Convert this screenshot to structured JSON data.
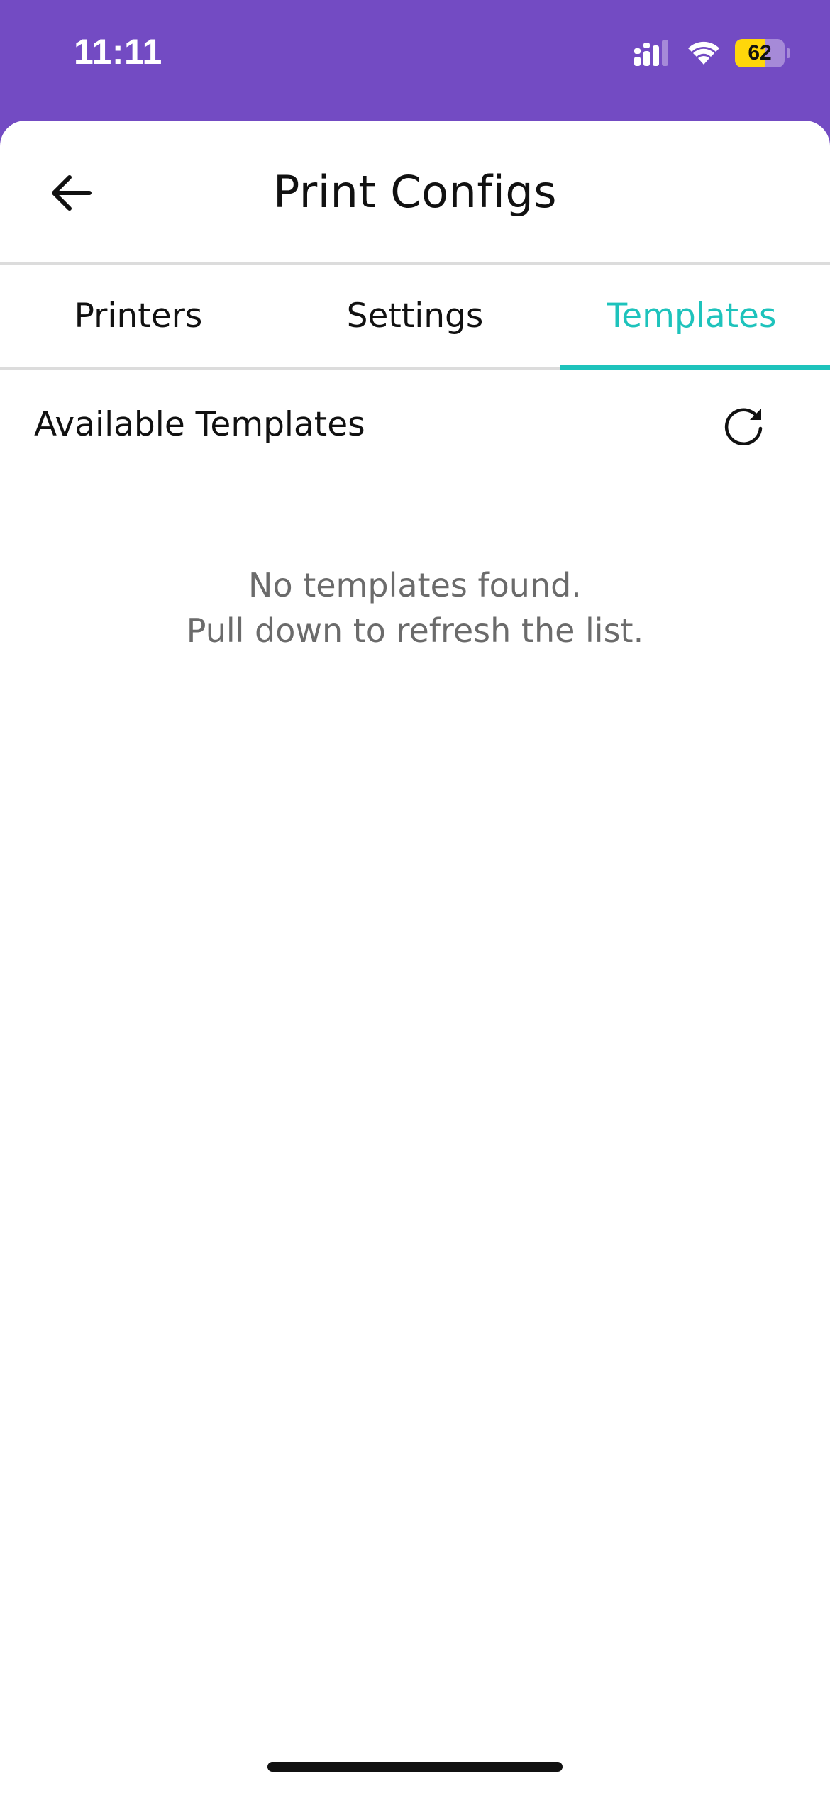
{
  "status_bar": {
    "time": "11:11",
    "battery_percent": "62",
    "battery_level": 0.62,
    "icons": [
      "signal-icon",
      "wifi-icon",
      "battery-icon"
    ]
  },
  "header": {
    "title": "Print Configs",
    "back_icon": "arrow-left-icon"
  },
  "tabs": [
    {
      "label": "Printers",
      "active": false
    },
    {
      "label": "Settings",
      "active": false
    },
    {
      "label": "Templates",
      "active": true
    }
  ],
  "section": {
    "title": "Available Templates",
    "refresh_icon": "refresh-icon"
  },
  "empty_state": {
    "line1": "No templates found.",
    "line2": "Pull down to refresh the list."
  },
  "colors": {
    "brand": "#734bc3",
    "accent": "#1ec3bc",
    "battery": "#ffd60a"
  }
}
